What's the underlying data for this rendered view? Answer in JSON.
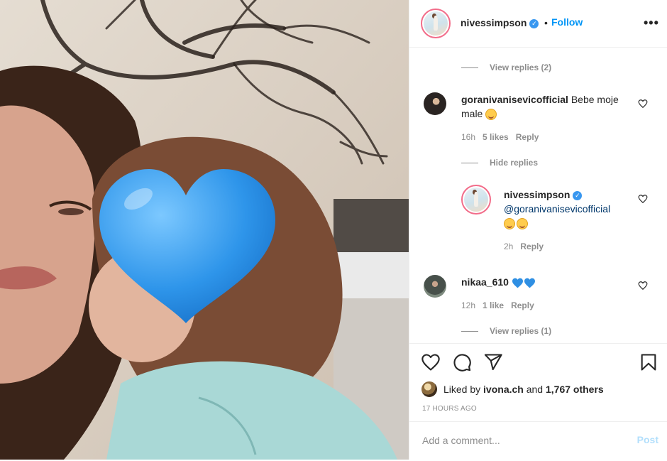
{
  "post": {
    "author": "nivessimpson",
    "follow_label": "Follow",
    "separator": "•",
    "more_label": "•••"
  },
  "comments": {
    "view_replies_top": "View replies (2)",
    "c1": {
      "user": "goranivanisevicofficial",
      "text_1": "Bebe moje",
      "text_2": "male",
      "time": "16h",
      "likes": "5 likes",
      "reply": "Reply"
    },
    "hide_replies": "Hide replies",
    "r1": {
      "user": "nivessimpson",
      "mention": "@goranivanisevicofficial",
      "time": "2h",
      "reply": "Reply"
    },
    "c2": {
      "user": "nikaa_610",
      "time": "12h",
      "likes": "1 like",
      "reply": "Reply"
    },
    "view_replies_bottom": "View replies (1)"
  },
  "footer": {
    "liked_by_prefix": "Liked by",
    "liked_by_user": "ivona.ch",
    "and": "and",
    "others": "1,767 others",
    "time_ago": "17 HOURS AGO",
    "add_comment_placeholder": "Add a comment...",
    "post_label": "Post"
  },
  "colors": {
    "accent": "#0095f6",
    "heart_blue": "#2f8fe3",
    "muted": "#8e8e8e"
  }
}
